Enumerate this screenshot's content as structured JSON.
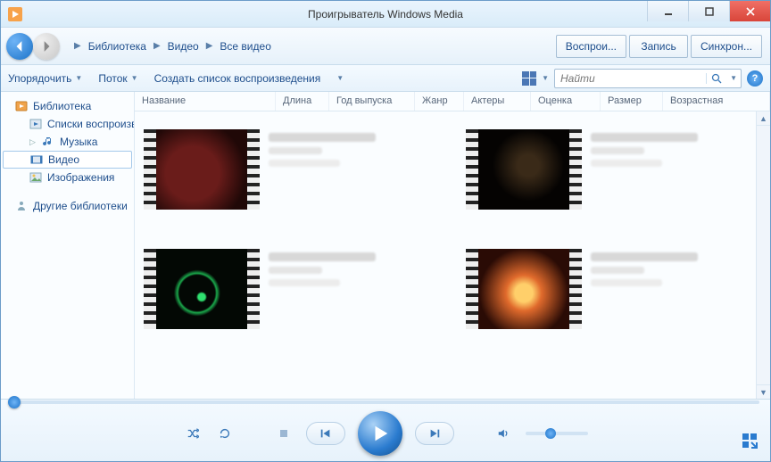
{
  "title": "Проигрыватель Windows Media",
  "breadcrumb": [
    "Библиотека",
    "Видео",
    "Все видео"
  ],
  "tabs": {
    "play": "Воспрои...",
    "burn": "Запись",
    "sync": "Синхрон..."
  },
  "toolbar": {
    "organize": "Упорядочить",
    "stream": "Поток",
    "create_playlist": "Создать список воспроизведения",
    "search_placeholder": "Найти"
  },
  "sidebar": {
    "library": "Библиотека",
    "playlists": "Списки воспроизве",
    "music": "Музыка",
    "video": "Видео",
    "pictures": "Изображения",
    "other_libs": "Другие библиотеки"
  },
  "columns": {
    "name": "Название",
    "length": "Длина",
    "year": "Год выпуска",
    "genre": "Жанр",
    "actors": "Актеры",
    "rating": "Оценка",
    "size": "Размер",
    "age": "Возрастная"
  }
}
